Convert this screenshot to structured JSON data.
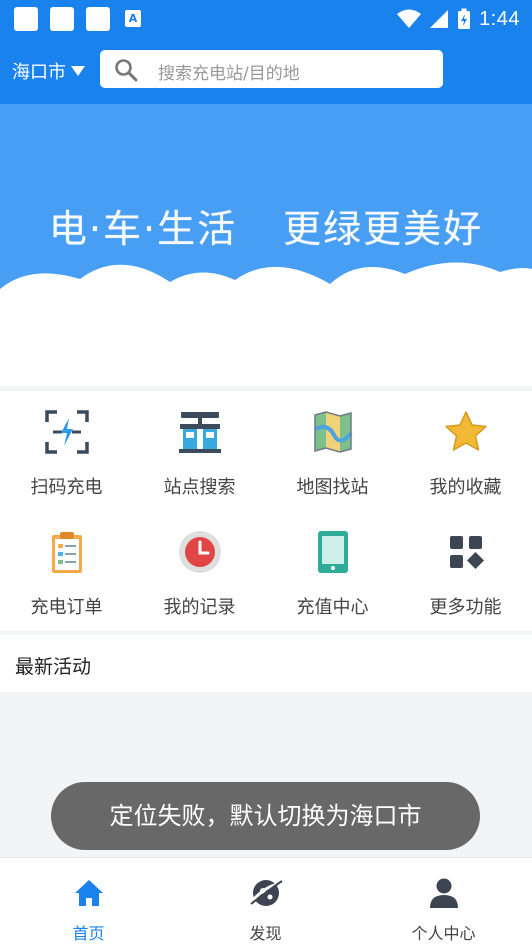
{
  "status_bar": {
    "time": "1:44"
  },
  "header": {
    "city": "海口市",
    "search_placeholder": "搜索充电站/目的地"
  },
  "banner": {
    "slogan_left": "电·车·生活",
    "slogan_right": "更绿更美好"
  },
  "grid": {
    "items": [
      {
        "label": "扫码充电",
        "icon": "scan-charge-icon"
      },
      {
        "label": "站点搜索",
        "icon": "station-search-icon"
      },
      {
        "label": "地图找站",
        "icon": "map-icon"
      },
      {
        "label": "我的收藏",
        "icon": "star-icon"
      },
      {
        "label": "充电订单",
        "icon": "order-clipboard-icon"
      },
      {
        "label": "我的记录",
        "icon": "clock-icon"
      },
      {
        "label": "充值中心",
        "icon": "tablet-icon"
      },
      {
        "label": "更多功能",
        "icon": "more-grid-icon"
      }
    ]
  },
  "news": {
    "title": "最新活动"
  },
  "toast": {
    "message": "定位失败，默认切换为海口市"
  },
  "tabbar": {
    "tabs": [
      {
        "label": "首页",
        "icon": "home-icon",
        "active": true
      },
      {
        "label": "发现",
        "icon": "discover-icon",
        "active": false
      },
      {
        "label": "个人中心",
        "icon": "person-icon",
        "active": false
      }
    ]
  },
  "colors": {
    "primary": "#1a82ec",
    "banner": "#479ef3",
    "toast_bg": "#686868"
  }
}
